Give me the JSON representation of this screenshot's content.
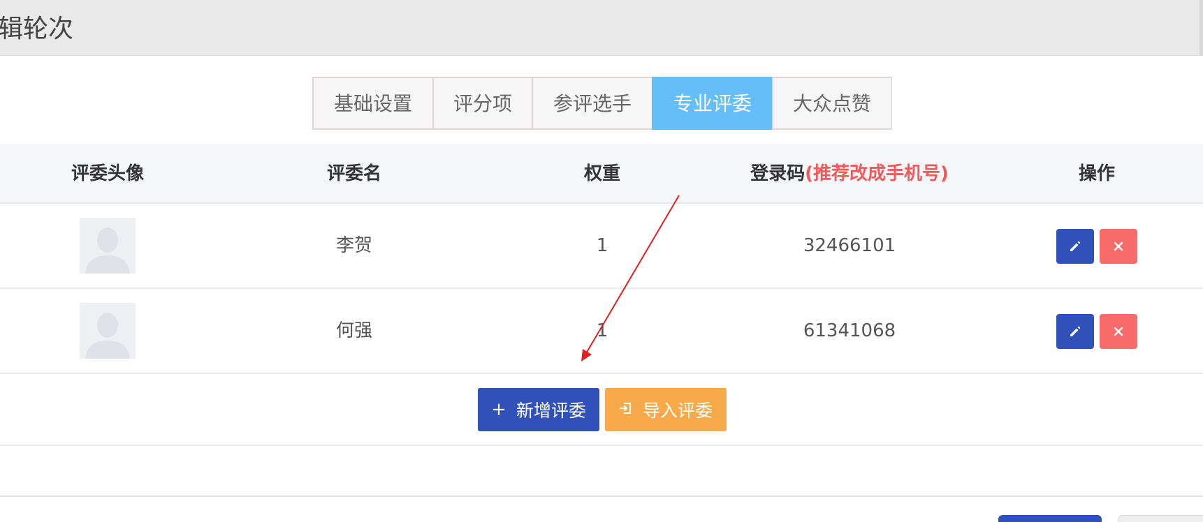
{
  "header": {
    "title": "辑轮次"
  },
  "tabs": [
    {
      "label": "基础设置",
      "active": false
    },
    {
      "label": "评分项",
      "active": false
    },
    {
      "label": "参评选手",
      "active": false
    },
    {
      "label": "专业评委",
      "active": true
    },
    {
      "label": "大众点赞",
      "active": false
    }
  ],
  "table": {
    "headers": {
      "avatar": "评委头像",
      "name": "评委名",
      "weight": "权重",
      "code": "登录码",
      "code_note": "(推荐改成手机号)",
      "ops": "操作"
    },
    "rows": [
      {
        "name": "李贺",
        "weight": "1",
        "code": "32466101"
      },
      {
        "name": "何强",
        "weight": "1",
        "code": "61341068"
      }
    ]
  },
  "actions": {
    "add_label": "新增评委",
    "import_label": "导入评委"
  },
  "icons": {
    "edit": "pencil-icon",
    "delete": "close-icon",
    "add": "plus-icon",
    "import": "import-icon",
    "avatar": "avatar-placeholder-icon"
  },
  "colors": {
    "primary": "#3052b8",
    "active_tab": "#66bef8",
    "danger": "#f86b6b",
    "warning": "#f8a94a",
    "note": "#f05a5a",
    "annotation_arrow": "#e02020"
  }
}
